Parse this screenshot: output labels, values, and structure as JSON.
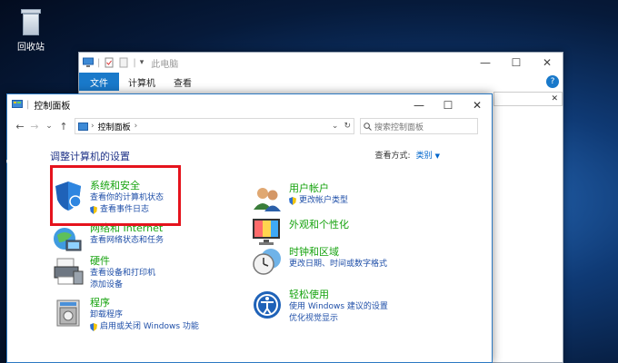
{
  "desktop": {
    "recycle_bin_label": "回收站"
  },
  "explorer_window": {
    "title": "此电脑",
    "ribbon_tabs": [
      "文件",
      "计算机",
      "查看"
    ],
    "help_label": "?",
    "controls": {
      "minimize": "—",
      "maximize": "☐",
      "close": "✕"
    },
    "close_search": "✕"
  },
  "control_panel": {
    "title": "控制面板",
    "controls": {
      "minimize": "—",
      "maximize": "☐",
      "close": "✕"
    },
    "nav": {
      "back": "←",
      "forward": "→",
      "recent": "⌄",
      "up": "↑"
    },
    "breadcrumb": {
      "item": "控制面板",
      "separator": "›",
      "dropdown": "⌄",
      "refresh": "↻"
    },
    "search": {
      "placeholder": "搜索控制面板"
    },
    "heading": "调整计算机的设置",
    "view_by": {
      "label": "查看方式:",
      "value": "类别"
    },
    "categories_left": [
      {
        "title": "系统和安全",
        "links": [
          "查看你的计算机状态",
          "查看事件日志"
        ],
        "shield": [
          false,
          true
        ],
        "icon": "shield-icon"
      },
      {
        "title": "网络和 Internet",
        "links": [
          "查看网络状态和任务"
        ],
        "shield": [
          false
        ],
        "icon": "network-icon"
      },
      {
        "title": "硬件",
        "links": [
          "查看设备和打印机",
          "添加设备"
        ],
        "shield": [
          false,
          false
        ],
        "icon": "printer-icon"
      },
      {
        "title": "程序",
        "links": [
          "卸载程序",
          "启用或关闭 Windows 功能"
        ],
        "shield": [
          false,
          true
        ],
        "icon": "programs-icon"
      }
    ],
    "categories_right": [
      {
        "title": "用户帐户",
        "links": [
          "更改帐户类型"
        ],
        "shield": [
          true
        ],
        "icon": "users-icon"
      },
      {
        "title": "外观和个性化",
        "links": [],
        "shield": [],
        "icon": "monitor-icon"
      },
      {
        "title": "时钟和区域",
        "links": [
          "更改日期、时间或数字格式"
        ],
        "shield": [
          false
        ],
        "icon": "clock-icon"
      },
      {
        "title": "轻松使用",
        "links": [
          "使用 Windows 建议的设置",
          "优化视觉显示"
        ],
        "shield": [
          false,
          false
        ],
        "icon": "accessibility-icon"
      }
    ]
  },
  "colors": {
    "accent": "#1979ca",
    "category_title": "#16a30e",
    "link": "#1f4fa8",
    "highlight": "#e5131d"
  }
}
